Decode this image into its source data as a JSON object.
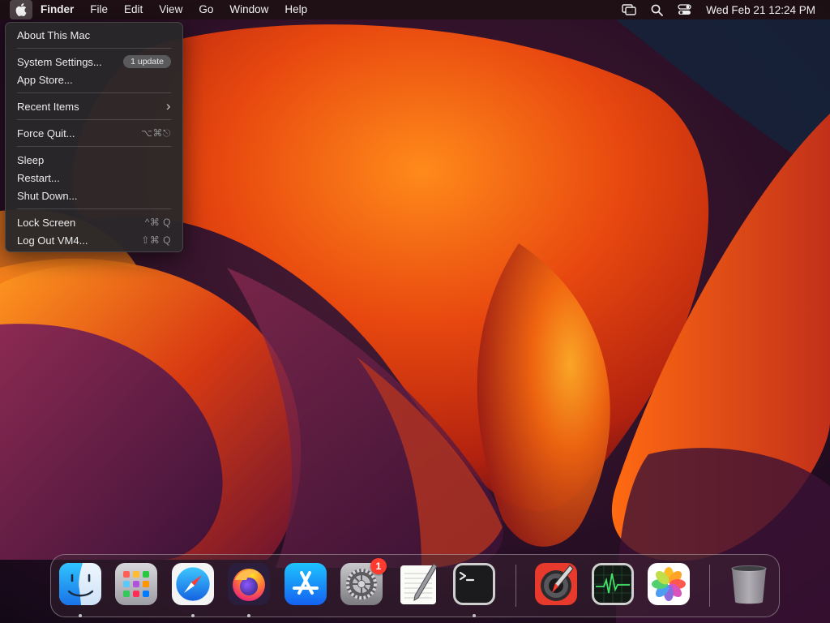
{
  "menubar": {
    "app_name": "Finder",
    "menus": [
      "File",
      "Edit",
      "View",
      "Go",
      "Window",
      "Help"
    ],
    "clock": "Wed Feb 21  12:24 PM",
    "right_icons": [
      "screen-mirroring-icon",
      "spotlight-search-icon",
      "control-center-icon"
    ]
  },
  "apple_menu": {
    "items": [
      {
        "label": "About This Mac"
      },
      {
        "label": "System Settings...",
        "badge": "1 update"
      },
      {
        "label": "App Store..."
      },
      {
        "label": "Recent Items",
        "submenu_glyph": "›"
      },
      {
        "label": "Force Quit...",
        "shortcut": "⌥⌘⎋"
      },
      {
        "label": "Sleep"
      },
      {
        "label": "Restart..."
      },
      {
        "label": "Shut Down..."
      },
      {
        "label": "Lock Screen",
        "shortcut": "^⌘ Q"
      },
      {
        "label": "Log Out VM4...",
        "shortcut": "⇧⌘ Q"
      }
    ]
  },
  "dock": {
    "apps": [
      {
        "name": "Finder",
        "icon": "finder-icon",
        "running": true
      },
      {
        "name": "Launchpad",
        "icon": "launchpad-icon",
        "running": false
      },
      {
        "name": "Safari",
        "icon": "safari-icon",
        "running": true
      },
      {
        "name": "Firefox",
        "icon": "firefox-icon",
        "running": true
      },
      {
        "name": "App Store",
        "icon": "app-store-icon",
        "running": false
      },
      {
        "name": "System Settings",
        "icon": "system-settings-icon",
        "running": false,
        "badge": "1"
      },
      {
        "name": "TextEdit",
        "icon": "textedit-icon",
        "running": false
      },
      {
        "name": "Terminal",
        "icon": "terminal-icon",
        "running": true
      },
      {
        "name": "Digital Color Meter",
        "icon": "color-meter-icon",
        "running": false
      },
      {
        "name": "Activity Monitor",
        "icon": "activity-monitor-icon",
        "running": false
      },
      {
        "name": "Photos",
        "icon": "photos-icon",
        "running": false
      },
      {
        "name": "Trash",
        "icon": "trash-icon",
        "running": false
      }
    ]
  },
  "colors": {
    "wallpaper_primary": "#e8480f",
    "wallpaper_dark": "#2a0d24",
    "badge_red": "#ff3b30"
  }
}
